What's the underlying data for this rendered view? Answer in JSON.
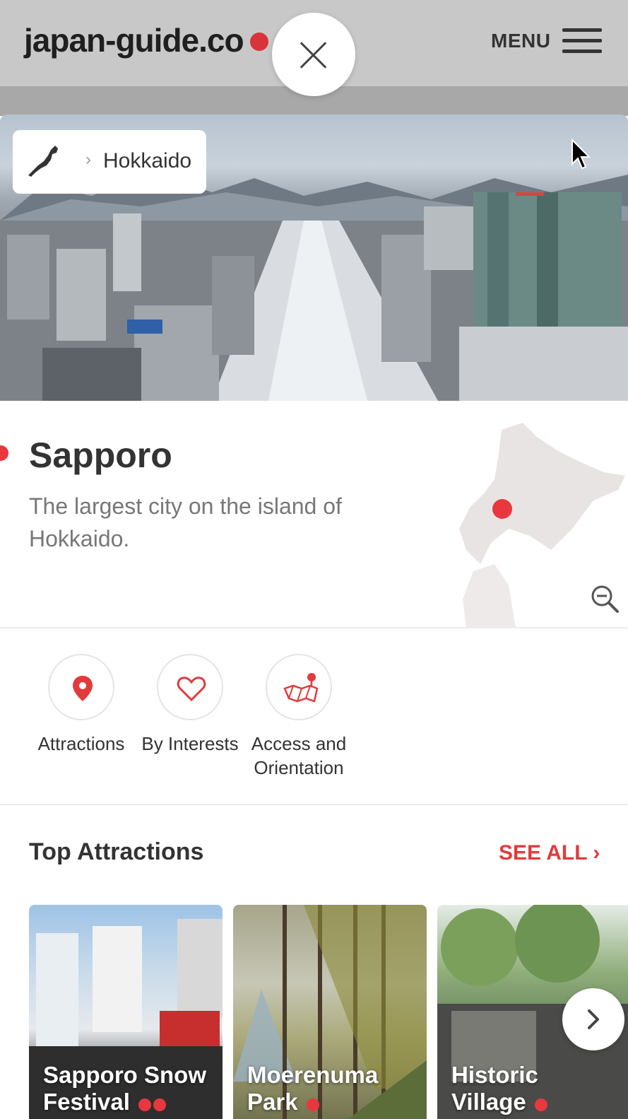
{
  "header": {
    "logo_text": "japan-guide.co",
    "menu_label": "MENU"
  },
  "breadcrumb": {
    "separator": "›",
    "current": "Hokkaido"
  },
  "intro": {
    "city_name": "Sapporo",
    "description": "The largest city on the island of Hokkaido."
  },
  "nav": {
    "items": [
      {
        "label": "Attractions",
        "icon": "location-pin-icon"
      },
      {
        "label": "By Interests",
        "icon": "heart-icon"
      },
      {
        "label": "Access and Orientation",
        "icon": "map-icon"
      }
    ]
  },
  "top_attractions": {
    "title": "Top Attractions",
    "see_all": "SEE ALL ›",
    "cards": [
      {
        "line1": "Sapporo Snow",
        "line2": "Festival",
        "dots": 2
      },
      {
        "line1": "Moerenuma",
        "line2": "Park",
        "dots": 1
      },
      {
        "line1": "Historic",
        "line2": "Village",
        "dots": 1
      }
    ]
  },
  "colors": {
    "accent": "#e23b3b",
    "header_bg": "#c8c8c8",
    "text": "#333333",
    "muted": "#777777"
  }
}
